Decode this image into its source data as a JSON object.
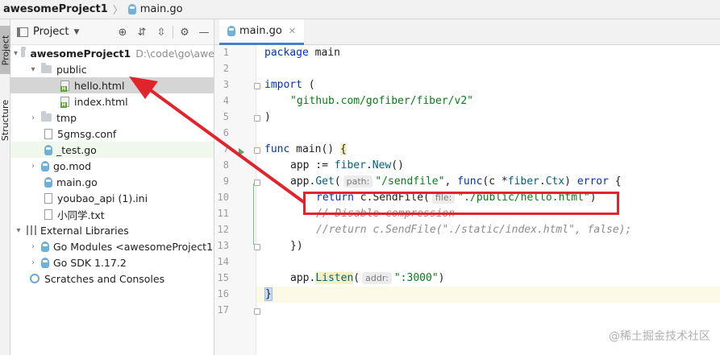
{
  "breadcrumb": {
    "project": "awesomeProject1",
    "file": "main.go"
  },
  "toolstrip": {
    "project_tab": "Project",
    "structure_tab": "Structure"
  },
  "project_panel": {
    "title": "Project",
    "tree": [
      {
        "label": "awesomeProject1",
        "note": "D:\\code\\go\\awe",
        "kind": "folder",
        "depth": 0,
        "expanded": true,
        "bold": true
      },
      {
        "label": "public",
        "kind": "folder",
        "depth": 1,
        "expanded": true
      },
      {
        "label": "hello.html",
        "kind": "html",
        "depth": 2,
        "selected": true
      },
      {
        "label": "index.html",
        "kind": "html",
        "depth": 2
      },
      {
        "label": "tmp",
        "kind": "folder",
        "depth": 1,
        "expanded": false
      },
      {
        "label": "5gmsg.conf",
        "kind": "file",
        "depth": 1
      },
      {
        "label": "_test.go",
        "kind": "go",
        "depth": 1,
        "highlighted": true
      },
      {
        "label": "go.mod",
        "kind": "go",
        "depth": 1
      },
      {
        "label": "main.go",
        "kind": "go",
        "depth": 1
      },
      {
        "label": "youbao_api (1).ini",
        "kind": "file",
        "depth": 1
      },
      {
        "label": "小同学.txt",
        "kind": "file",
        "depth": 1
      },
      {
        "label": "External Libraries",
        "kind": "library",
        "depth": 0,
        "expanded": true
      },
      {
        "label": "Go Modules <awesomeProject1",
        "kind": "go",
        "depth": 1
      },
      {
        "label": "Go SDK 1.17.2",
        "kind": "go",
        "depth": 1
      },
      {
        "label": "Scratches and Consoles",
        "kind": "scratch",
        "depth": 0
      }
    ]
  },
  "editor": {
    "tab": "main.go",
    "lines": [
      "1",
      "2",
      "3",
      "4",
      "5",
      "6",
      "7",
      "8",
      "9",
      "10",
      "11",
      "12",
      "13",
      "14",
      "15",
      "16",
      "17"
    ],
    "code": {
      "l1_kw": "package",
      "l1_name": " main",
      "l3_kw": "import",
      "l3_rest": " (",
      "l4_str": "\"github.com/gofiber/fiber/v2\"",
      "l5": ")",
      "l7_kw": "func",
      "l7_rest": " main() ",
      "l7_brace": "{",
      "l8_a": "app := ",
      "l8_pkg": "fiber",
      "l8_b": ".",
      "l8_fn": "New",
      "l8_c": "()",
      "l9_a": "app.",
      "l9_fn": "Get",
      "l9_b": "(",
      "l9_hint": "path:",
      "l9_str": "\"/sendfile\"",
      "l9_c": ", ",
      "l9_kw": "func",
      "l9_d": "(c *",
      "l9_pkg": "fiber",
      "l9_e": ".",
      "l9_type": "Ctx",
      "l9_f": ") ",
      "l9_kw2": "error",
      "l9_g": " {",
      "l10_kw": "return",
      "l10_a": " c.SendFile(",
      "l10_hint": "file:",
      "l10_str": "\"./public/hello.html\"",
      "l10_b": ")",
      "l11_cm": "// Disable compression",
      "l12_cm": "//return c.SendFile(\"./static/index.html\", false);",
      "l13": "})",
      "l15_a": "app.",
      "l15_fn": "Listen",
      "l15_b": "(",
      "l15_hint": "addr:",
      "l15_str": "\":3000\"",
      "l15_c": ")",
      "l16": "}"
    }
  },
  "watermark": "@稀土掘金技术社区",
  "colors": {
    "annotation": "#e1242c",
    "keyword": "#0033b3",
    "string": "#067d17",
    "comment": "#8c8c8c"
  }
}
